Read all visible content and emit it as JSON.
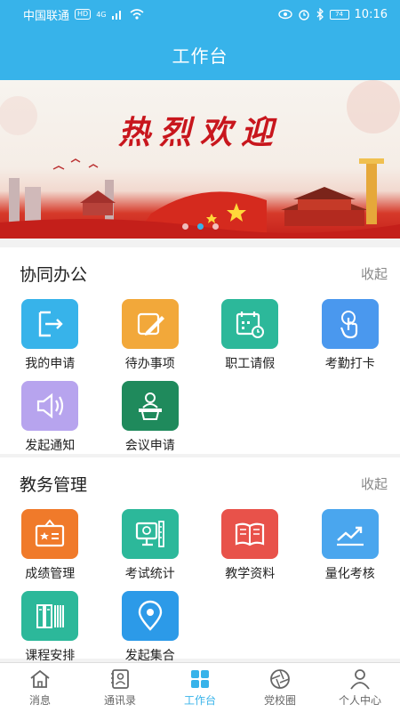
{
  "status": {
    "carrier": "中国联通",
    "net_badge": "HD",
    "signal": "4G",
    "battery": "74",
    "time": "10:16"
  },
  "header": {
    "title": "工作台"
  },
  "banner": {
    "title": "热烈欢迎",
    "dots": 3,
    "active_dot": 1
  },
  "sections": [
    {
      "title": "协同办公",
      "action": "收起",
      "items": [
        {
          "label": "我的申请",
          "icon": "export-icon",
          "color": "#37b3ea"
        },
        {
          "label": "待办事项",
          "icon": "pencil-note-icon",
          "color": "#f2a83a"
        },
        {
          "label": "职工请假",
          "icon": "calendar-clock-icon",
          "color": "#2cb89a"
        },
        {
          "label": "考勤打卡",
          "icon": "tap-hand-icon",
          "color": "#4a98ee"
        },
        {
          "label": "发起通知",
          "icon": "speaker-icon",
          "color": "#b7a4ee"
        },
        {
          "label": "会议申请",
          "icon": "podium-icon",
          "color": "#1f8a5c"
        }
      ]
    },
    {
      "title": "教务管理",
      "action": "收起",
      "items": [
        {
          "label": "成绩管理",
          "icon": "certificate-icon",
          "color": "#f07a2a"
        },
        {
          "label": "考试统计",
          "icon": "monitor-ruler-icon",
          "color": "#2cb89a"
        },
        {
          "label": "教学资料",
          "icon": "open-book-icon",
          "color": "#e8524a"
        },
        {
          "label": "量化考核",
          "icon": "trend-up-icon",
          "color": "#4aa6ee"
        },
        {
          "label": "课程安排",
          "icon": "books-icon",
          "color": "#2cb89a"
        },
        {
          "label": "发起集合",
          "icon": "location-pin-icon",
          "color": "#2c9ae8"
        }
      ]
    }
  ],
  "nav": [
    {
      "label": "消息",
      "icon": "home-icon"
    },
    {
      "label": "通讯录",
      "icon": "contacts-icon"
    },
    {
      "label": "工作台",
      "icon": "grid-icon",
      "active": true
    },
    {
      "label": "党校圈",
      "icon": "aperture-icon"
    },
    {
      "label": "个人中心",
      "icon": "person-icon"
    }
  ],
  "colors": {
    "primary": "#37b3ea",
    "banner_red": "#c8161d"
  }
}
